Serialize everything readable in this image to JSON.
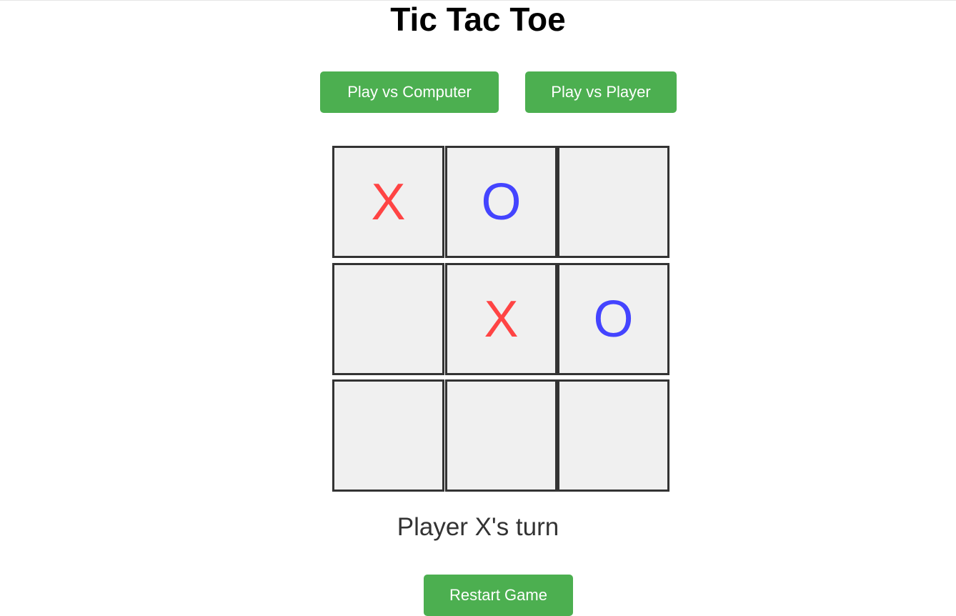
{
  "title": "Tic Tac Toe",
  "mode_buttons": {
    "vs_computer": "Play vs Computer",
    "vs_player": "Play vs Player"
  },
  "board": {
    "cells": [
      "X",
      "O",
      "",
      "",
      "X",
      "O",
      "",
      "",
      ""
    ]
  },
  "status": "Player X's turn",
  "restart_label": "Restart Game",
  "colors": {
    "accent": "#4caf50",
    "x_mark": "#ff4444",
    "o_mark": "#4444ff",
    "cell_bg": "#f0f0f0",
    "cell_border": "#333333"
  }
}
